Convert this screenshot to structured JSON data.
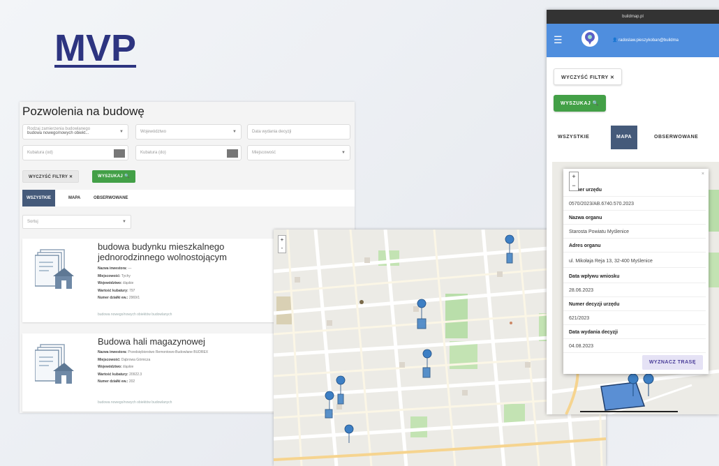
{
  "slide": {
    "title": "MVP"
  },
  "list": {
    "title": "Pozwolenia na budowę",
    "filters": {
      "category_label": "Rodzaj zamierzenia budowlanego",
      "category_value": "budowa nowego/nowych obiekt...",
      "voivodeship_placeholder": "Województwo",
      "decision_date_placeholder": "Data wydania decyzji",
      "cubature_from_placeholder": "Kubatura (od)",
      "cubature_to_placeholder": "Kubatura (do)",
      "locality_placeholder": "Miejscowość"
    },
    "clear_button": "WYCZYŚĆ FILTRY ✕",
    "search_button": "WYSZUKAJ 🔍",
    "tabs": [
      {
        "label": "WSZYSTKIE",
        "active": true
      },
      {
        "label": "MAPA",
        "active": false
      },
      {
        "label": "OBSERWOWANE",
        "active": false
      }
    ],
    "sort_placeholder": "Sortuj",
    "cards": [
      {
        "title": "budowa budynku mieszkalnego jednorodzinnego wolnostojącym",
        "fields": [
          {
            "label": "Nazwa inwestora:",
            "value": "—"
          },
          {
            "label": "Miejscowość:",
            "value": "Tychy"
          },
          {
            "label": "Województwo:",
            "value": "śląskie"
          },
          {
            "label": "Wartość kubatury:",
            "value": "797"
          },
          {
            "label": "Numer działki ew.:",
            "value": "2969/1"
          }
        ],
        "tag": "budowa nowego/nowych obiektów budowlanych"
      },
      {
        "title": "Budowa hali magazynowej",
        "fields": [
          {
            "label": "Nazwa inwestora:",
            "value": "Przedsiębiorstwo Remontowo-Budowlane BUDREX"
          },
          {
            "label": "Miejscowość:",
            "value": "Dąbrowa Górnicza"
          },
          {
            "label": "Województwo:",
            "value": "śląskie"
          },
          {
            "label": "Wartość kubatury:",
            "value": "20922.3"
          },
          {
            "label": "Numer działki ew.:",
            "value": "202"
          }
        ],
        "tag": "budowa nowego/nowych obiektów budowlanych"
      }
    ]
  },
  "map": {
    "zoom_in": "+",
    "zoom_out": "-"
  },
  "phone": {
    "status_title": "buildmap.pl",
    "user": "radoslaw.pieszykoban@buildma",
    "clear_button": "WYCZYŚĆ FILTRY ✕",
    "search_button": "WYSZUKAJ 🔍",
    "tabs": [
      {
        "label": "WSZYSTKIE",
        "active": false
      },
      {
        "label": "MAPA",
        "active": true
      },
      {
        "label": "OBSERWOWANE",
        "active": false
      }
    ],
    "popup": {
      "zoom_in": "+",
      "zoom_out": "−",
      "close": "×",
      "rows": [
        {
          "label": "Numer urzędu",
          "value": "0570/2023/AB.6740.570.2023"
        },
        {
          "label": "Nazwa organu",
          "value": "Starosta Powiatu Myślenice"
        },
        {
          "label": "Adres organu",
          "value": "ul. Mikołaja Reja 13, 32-400 Myślenice"
        },
        {
          "label": "Data wpływu wniosku",
          "value": "28.06.2023"
        },
        {
          "label": "Numer decyzji urzędu",
          "value": "621/2023"
        },
        {
          "label": "Data wydania decyzji",
          "value": "04.08.2023"
        }
      ],
      "route_button": "WYZNACZ TRASĘ"
    }
  },
  "colors": {
    "title": "#2d3480",
    "tab_active": "#455a7a",
    "search": "#43a047",
    "appbar": "#4f8ede",
    "marker": "#3d7fc4"
  }
}
